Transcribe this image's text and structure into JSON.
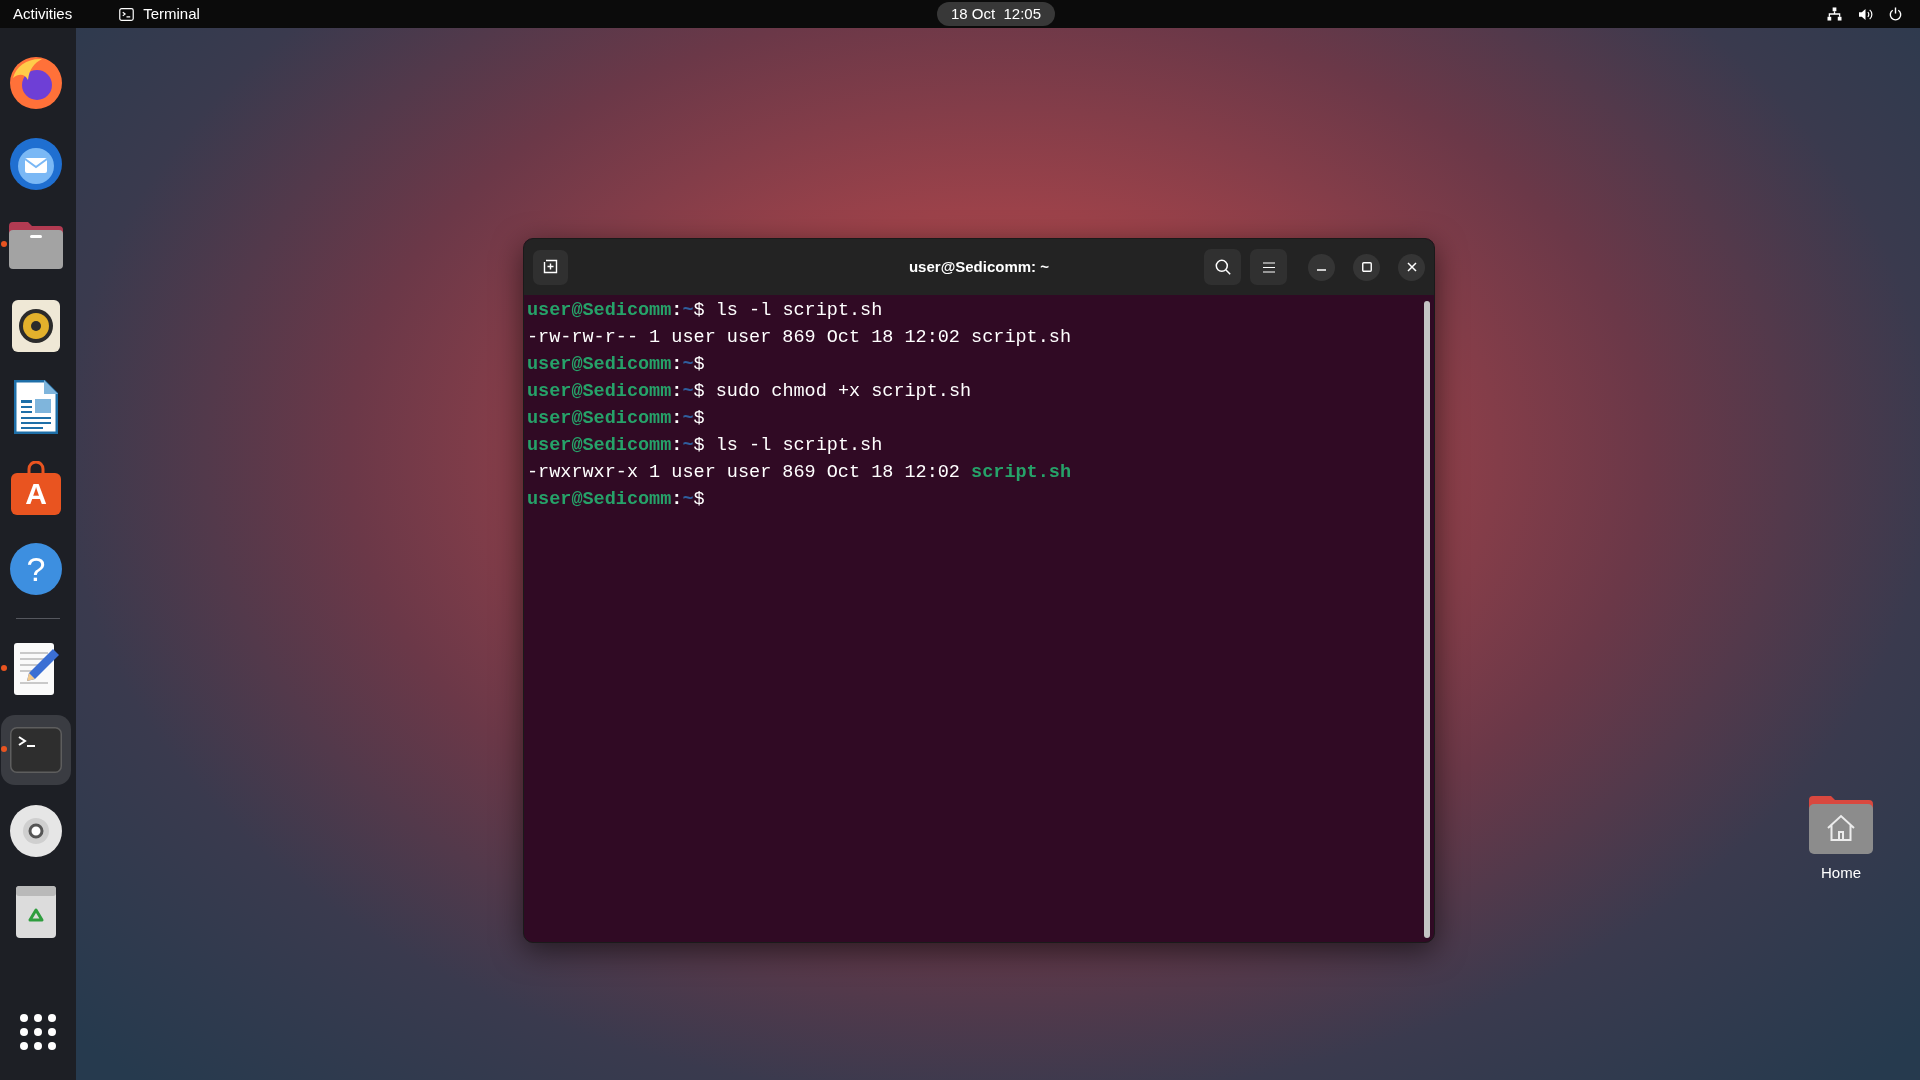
{
  "top_bar": {
    "activities": "Activities",
    "app_menu": "Terminal",
    "clock": "18 Oct  12:05"
  },
  "dock": {
    "favorites": [
      {
        "kind": "browser",
        "running": false,
        "selected": false
      },
      {
        "kind": "mail",
        "running": false,
        "selected": false
      },
      {
        "kind": "files",
        "running": true,
        "selected": false
      },
      {
        "kind": "music",
        "running": false,
        "selected": false
      },
      {
        "kind": "writer",
        "running": false,
        "selected": false
      },
      {
        "kind": "store",
        "glyph": "A",
        "running": false,
        "selected": false
      },
      {
        "kind": "help",
        "glyph": "?",
        "running": false,
        "selected": false
      }
    ],
    "others": [
      {
        "kind": "editor",
        "running": true,
        "selected": false
      },
      {
        "kind": "terminal",
        "running": true,
        "selected": true
      },
      {
        "kind": "disc",
        "running": false,
        "selected": false
      },
      {
        "kind": "trash",
        "running": false,
        "selected": false
      }
    ]
  },
  "terminal": {
    "title": "user@Sedicomm: ~",
    "lines": [
      {
        "kind": "prompt",
        "user_host": "user@Sedicomm",
        "separator": ":",
        "cwd": "~",
        "symbol": "$",
        "command": "ls -l script.sh"
      },
      {
        "kind": "output",
        "text": "-rw-rw-r-- 1 user user 869 Oct 18 12:02",
        "file": "script.sh",
        "executable": false
      },
      {
        "kind": "prompt",
        "user_host": "user@Sedicomm",
        "separator": ":",
        "cwd": "~",
        "symbol": "$"
      },
      {
        "kind": "prompt",
        "user_host": "user@Sedicomm",
        "separator": ":",
        "cwd": "~",
        "symbol": "$",
        "command": "sudo chmod +x script.sh"
      },
      {
        "kind": "prompt",
        "user_host": "user@Sedicomm",
        "separator": ":",
        "cwd": "~",
        "symbol": "$"
      },
      {
        "kind": "prompt",
        "user_host": "user@Sedicomm",
        "separator": ":",
        "cwd": "~",
        "symbol": "$",
        "command": "ls -l script.sh"
      },
      {
        "kind": "output",
        "text": "-rwxrwxr-x 1 user user 869 Oct 18 12:02",
        "file": "script.sh",
        "executable": true
      },
      {
        "kind": "prompt",
        "user_host": "user@Sedicomm",
        "separator": ":",
        "cwd": "~",
        "symbol": "$"
      }
    ]
  },
  "desktop_icons": [
    {
      "label": "Home"
    }
  ]
}
